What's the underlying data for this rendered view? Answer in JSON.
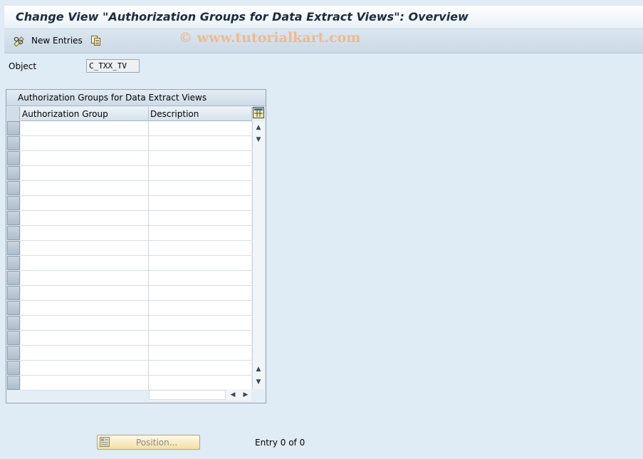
{
  "window": {
    "title": "Change View \"Authorization Groups for Data Extract Views\": Overview"
  },
  "watermark": "© www.tutorialkart.com",
  "toolbar": {
    "new_entries_label": "New Entries",
    "icons": [
      "edit-glasses-icon",
      "copy-icon"
    ]
  },
  "object_field": {
    "label": "Object",
    "value": "C_TXX_TV"
  },
  "table": {
    "title": "Authorization Groups for Data Extract Views",
    "columns": [
      "Authorization Group",
      "Description"
    ],
    "rows": [],
    "visible_row_count": 18
  },
  "footer": {
    "position_button_label": "Position...",
    "entry_text": "Entry 0 of 0"
  },
  "colors": {
    "background": "#dfebf5",
    "title_text": "#1c2c3c",
    "watermark": "#f0b888",
    "position_button": "#f1dfa5"
  }
}
